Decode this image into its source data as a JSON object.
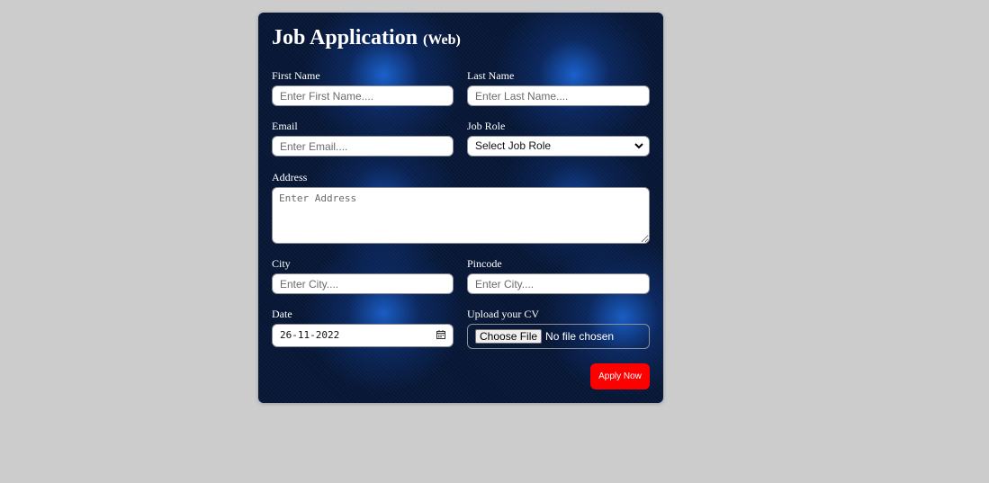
{
  "form": {
    "title": "Job Application",
    "title_sub": "(Web)",
    "first_name": {
      "label": "First Name",
      "placeholder": "Enter First Name...."
    },
    "last_name": {
      "label": "Last Name",
      "placeholder": "Enter Last Name...."
    },
    "email": {
      "label": "Email",
      "placeholder": "Enter Email...."
    },
    "job_role": {
      "label": "Job Role",
      "selected": "Select Job Role"
    },
    "address": {
      "label": "Address",
      "placeholder": "Enter Address"
    },
    "city": {
      "label": "City",
      "placeholder": "Enter City...."
    },
    "pincode": {
      "label": "Pincode",
      "placeholder": "Enter City...."
    },
    "date": {
      "label": "Date",
      "value": "26-11-2022"
    },
    "cv": {
      "label": "Upload your CV",
      "button": "Choose File",
      "status": "No file chosen"
    },
    "submit_label": "Apply Now"
  },
  "icons": {
    "job_role_dropdown": "chevron-down-icon",
    "date_picker": "calendar-icon"
  },
  "colors": {
    "page_background": "#cccccc",
    "card_background": "#061634",
    "accent_glow": "#1e6ee6",
    "submit_button": "#ff0000"
  }
}
